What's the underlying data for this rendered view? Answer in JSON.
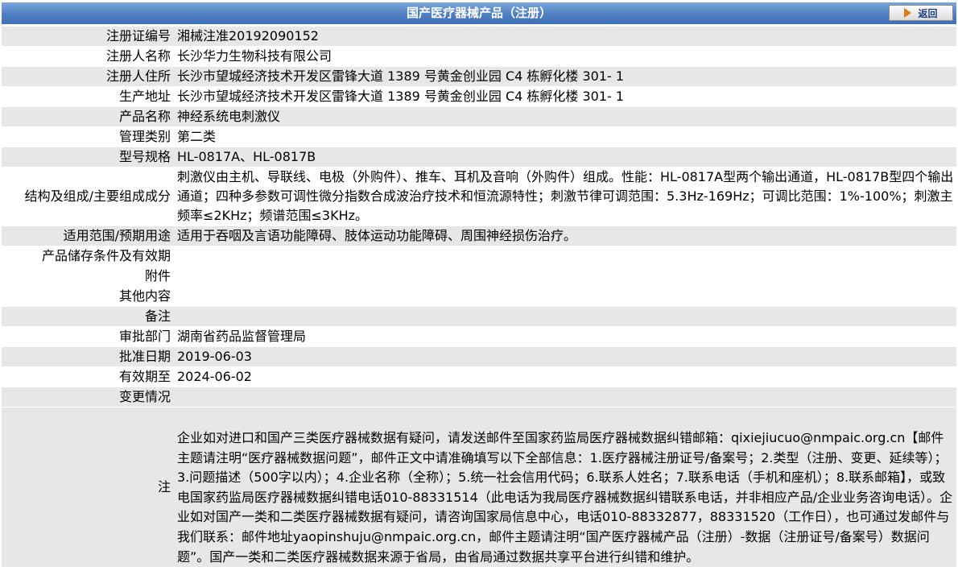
{
  "header": {
    "title": "国产医疗器械产品（注册）",
    "back_label": "返回"
  },
  "fields": [
    {
      "label": "注册证编号",
      "value": "湘械注准20192090152"
    },
    {
      "label": "注册人名称",
      "value": "长沙华力生物科技有限公司"
    },
    {
      "label": "注册人住所",
      "value": "长沙市望城经济技术开发区雷锋大道 1389 号黄金创业园 C4 栋孵化楼 301- 1"
    },
    {
      "label": "生产地址",
      "value": "长沙市望城经济技术开发区雷锋大道 1389 号黄金创业园 C4 栋孵化楼 301- 1"
    },
    {
      "label": "产品名称",
      "value": "神经系统电刺激仪"
    },
    {
      "label": "管理类别",
      "value": "第二类"
    },
    {
      "label": "型号规格",
      "value": "HL-0817A、HL-0817B"
    },
    {
      "label": "结构及组成/主要组成成分",
      "value": "刺激仪由主机、导联线、电极（外购件）、推车、耳机及音响（外购件）组成。性能：HL-0817A型两个输出通道，HL-0817B型四个输出通道；四种多参数可调性微分指数合成波治疗技术和恒流源特性；刺激节律可调范围：5.3Hz-169Hz；可调比范围：1%-100%；刺激主频率≤2KHz；频谱范围≤3KHz。"
    },
    {
      "label": "适用范围/预期用途",
      "value": "适用于吞咽及言语功能障碍、肢体运动功能障碍、周围神经损伤治疗。"
    },
    {
      "label": "产品储存条件及有效期",
      "value": ""
    },
    {
      "label": "附件",
      "value": ""
    },
    {
      "label": "其他内容",
      "value": ""
    },
    {
      "label": "备注",
      "value": ""
    },
    {
      "label": "审批部门",
      "value": "湖南省药品监督管理局"
    },
    {
      "label": "批准日期",
      "value": "2019-06-03"
    },
    {
      "label": "有效期至",
      "value": "2024-06-02"
    },
    {
      "label": "变更情况",
      "value": ""
    }
  ],
  "note": {
    "label": "注",
    "text": "企业如对进口和国产三类医疗器械数据有疑问，请发送邮件至国家药监局医疗器械数据纠错邮箱：qixiejiucuo@nmpaic.org.cn【邮件主题请注明“医疗器械数据问题”，邮件正文中请准确填写以下全部信息：1.医疗器械注册证号/备案号；2.类型（注册、变更、延续等）；3.问题描述（500字以内）；4.企业名称（全称）；5.统一社会信用代码；6.联系人姓名；7.联系电话（手机和座机）；8.联系邮箱】，或致电国家药监局医疗器械数据纠错电话010-88331514（此电话为我局医疗器械数据纠错联系电话，并非相应产品/企业业务咨询电话）。企业如对国产一类和二类医疗器械数据有疑问，请咨询国家局信息中心，电话010-88332877，88331520（工作日），也可通过发邮件与我们联系：邮件地址yaopinshuju@nmpaic.org.cn，邮件主题请注明“国产医疗器械产品（注册）-数据（注册证号/备案号）数据问题”。国产一类和二类医疗器械数据来源于省局，由省局通过数据共享平台进行纠错和维护。"
  },
  "colors": {
    "header_bg": "#4f7fc2",
    "row_gray": "#e7e7e7",
    "row_white": "#ffffff"
  },
  "icons": {
    "back": "arrow-right-icon"
  }
}
